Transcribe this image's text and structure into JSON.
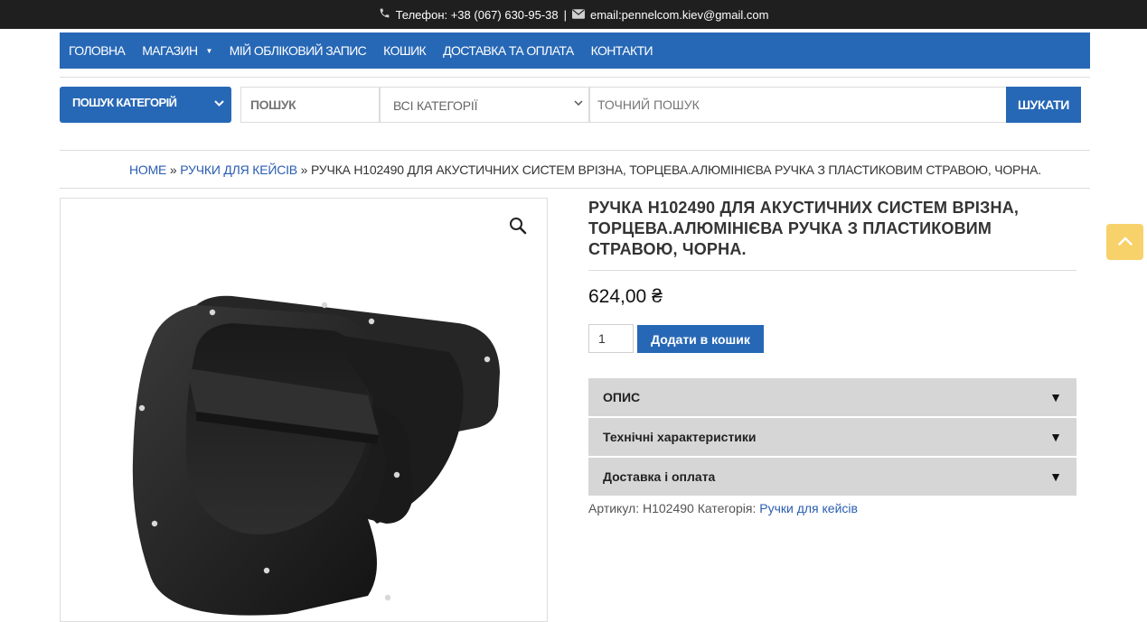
{
  "topbar": {
    "phone_icon": "phone-icon",
    "phone": "Телефон: +38 (067) 630-95-38",
    "separator": "|",
    "mail_icon": "envelope-icon",
    "email": "email:pennelcom.kiev@gmail.com"
  },
  "nav": {
    "items": [
      {
        "label": "ГОЛОВНА"
      },
      {
        "label": "МАГАЗИН",
        "has_dropdown": true
      },
      {
        "label": "МІЙ ОБЛІКОВИЙ ЗАПИС"
      },
      {
        "label": "КОШИК"
      },
      {
        "label": "ДОСТАВКА ТА ОПЛАТА"
      },
      {
        "label": "КОНТАКТИ"
      }
    ]
  },
  "search": {
    "category_button": "ПОШУК КАТЕГОРІЙ",
    "query_placeholder": "ПОШУК",
    "category_select": "ВСІ КАТЕГОРІЇ",
    "exact_placeholder": "ТОЧНИЙ ПОШУК",
    "submit": "ШУКАТИ"
  },
  "breadcrumb": {
    "home": "HOME",
    "sep": "»",
    "category": "РУЧКИ ДЛЯ КЕЙСІВ",
    "current": "РУЧКА H102490 ДЛЯ АКУСТИЧНИХ СИСТЕМ ВРІЗНА, ТОРЦЕВА.АЛЮМІНІЄВА РУЧКА З ПЛАСТИКОВИМ СТРАВОЮ, ЧОРНА."
  },
  "product": {
    "title": "РУЧКА H102490 ДЛЯ АКУСТИЧНИХ СИСТЕМ ВРІЗНА, ТОРЦЕВА.АЛЮМІНІЄВА РУЧКА З ПЛАСТИКОВИМ СТРАВОЮ, ЧОРНА.",
    "price": "624,00 ₴",
    "quantity": "1",
    "add_to_cart": "Додати в кошик",
    "zoom_icon": "magnifier-icon"
  },
  "accordion": [
    {
      "label": "ОПИС",
      "arrow": "▼"
    },
    {
      "label": "Технічні характеристики",
      "arrow": "▼"
    },
    {
      "label": "Доставка і оплата",
      "arrow": "▼"
    }
  ],
  "meta": {
    "sku_label": "Артикул:",
    "sku": "H102490",
    "category_label": "Категорія:",
    "category": "Ручки для кейсів"
  },
  "colors": {
    "topbar": "#1f1f1f",
    "primary": "#2768b6",
    "accordion": "#d6d6d6",
    "to_top": "#f7d26b"
  }
}
